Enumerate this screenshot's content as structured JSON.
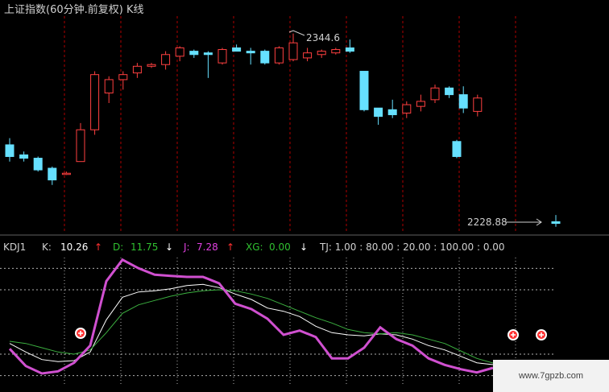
{
  "colors": {
    "up": "#ff4040",
    "down": "#66e0ff",
    "grid": "#b00000",
    "k": "#ffffff",
    "d": "#3cb040",
    "j": "#d050d0",
    "text": "#d0d0d0",
    "k_value": "#ffffff",
    "d_value": "#30c030",
    "j_value": "#e040e0",
    "xg_value": "#30c030",
    "arrow_up": "#ff3030",
    "arrow_down": "#ffffff",
    "dotted": "#b0b0b0",
    "marker": "#ff3030"
  },
  "main": {
    "title": "上证指数(60分钟.前复权) K线",
    "high_label": "2344.6",
    "low_label": "2228.88"
  },
  "indicator": {
    "name": "KDJ1",
    "k_label": "K:",
    "k_value": "10.26",
    "k_arrow": "↑",
    "d_label": "D:",
    "d_value": "11.75",
    "d_arrow": "↓",
    "j_label": "J:",
    "j_value": "7.28",
    "j_arrow": "↑",
    "xg_label": "XG:",
    "xg_value": "0.00",
    "xg_arrow": "↓",
    "tj_text": "TJ: 1.00  : 80.00 : 20.00 : 100.00 : 0.00"
  },
  "watermark": "www.7gpzb.com",
  "chart_data": [
    {
      "type": "candlestick",
      "title": "上证指数(60分钟.前复权) K线",
      "ylim": [
        2225,
        2355
      ],
      "annotations": [
        {
          "label": "2344.6",
          "value": 2344.6
        },
        {
          "label": "2228.88",
          "value": 2228.88
        }
      ],
      "candles": [
        {
          "o": 2278,
          "h": 2282,
          "l": 2268,
          "c": 2271
        },
        {
          "o": 2272,
          "h": 2274,
          "l": 2268,
          "c": 2270
        },
        {
          "o": 2270,
          "h": 2271,
          "l": 2262,
          "c": 2263
        },
        {
          "o": 2264,
          "h": 2265,
          "l": 2254,
          "c": 2257
        },
        {
          "o": 2261,
          "h": 2262,
          "l": 2260,
          "c": 2261
        },
        {
          "o": 2268,
          "h": 2291,
          "l": 2268,
          "c": 2287
        },
        {
          "o": 2287,
          "h": 2322,
          "l": 2284,
          "c": 2320
        },
        {
          "o": 2309,
          "h": 2319,
          "l": 2303,
          "c": 2317
        },
        {
          "o": 2317,
          "h": 2322,
          "l": 2311,
          "c": 2320
        },
        {
          "o": 2321,
          "h": 2327,
          "l": 2318,
          "c": 2325
        },
        {
          "o": 2325,
          "h": 2327,
          "l": 2324,
          "c": 2326
        },
        {
          "o": 2326,
          "h": 2334,
          "l": 2323,
          "c": 2332
        },
        {
          "o": 2331,
          "h": 2337,
          "l": 2328,
          "c": 2336
        },
        {
          "o": 2334,
          "h": 2335,
          "l": 2330,
          "c": 2332
        },
        {
          "o": 2333,
          "h": 2334,
          "l": 2318,
          "c": 2332
        },
        {
          "o": 2327,
          "h": 2336,
          "l": 2326,
          "c": 2335
        },
        {
          "o": 2336,
          "h": 2338,
          "l": 2335,
          "c": 2334
        },
        {
          "o": 2334,
          "h": 2336,
          "l": 2326,
          "c": 2333
        },
        {
          "o": 2334,
          "h": 2335,
          "l": 2326,
          "c": 2327
        },
        {
          "o": 2327,
          "h": 2337,
          "l": 2326,
          "c": 2336
        },
        {
          "o": 2329,
          "h": 2344.6,
          "l": 2328,
          "c": 2339
        },
        {
          "o": 2330,
          "h": 2336,
          "l": 2328,
          "c": 2333
        },
        {
          "o": 2332,
          "h": 2335,
          "l": 2330,
          "c": 2334
        },
        {
          "o": 2333,
          "h": 2336,
          "l": 2332,
          "c": 2335
        },
        {
          "o": 2336,
          "h": 2341,
          "l": 2333,
          "c": 2334
        },
        {
          "o": 2322,
          "h": 2322,
          "l": 2298,
          "c": 2299
        },
        {
          "o": 2300,
          "h": 2300,
          "l": 2290,
          "c": 2295
        },
        {
          "o": 2299,
          "h": 2305,
          "l": 2294,
          "c": 2296
        },
        {
          "o": 2297,
          "h": 2304,
          "l": 2294,
          "c": 2302
        },
        {
          "o": 2301,
          "h": 2308,
          "l": 2298,
          "c": 2304
        },
        {
          "o": 2305,
          "h": 2314,
          "l": 2303,
          "c": 2312
        },
        {
          "o": 2312,
          "h": 2313,
          "l": 2306,
          "c": 2308
        },
        {
          "o": 2308,
          "h": 2313,
          "l": 2297,
          "c": 2300
        },
        {
          "o": 2298,
          "h": 2308,
          "l": 2295,
          "c": 2306
        },
        {
          "o": 2280,
          "h": 2281,
          "l": 2270,
          "c": 2271
        },
        {
          "o": 2232,
          "h": 2236,
          "l": 2229,
          "c": 2231
        }
      ]
    },
    {
      "type": "line",
      "title": "KDJ1",
      "ylim": [
        -10,
        110
      ],
      "reference_lines": [
        80,
        20,
        100,
        0
      ],
      "series": [
        {
          "name": "K",
          "values": [
            30,
            22,
            15,
            13,
            14,
            22,
            52,
            73,
            78,
            79,
            81,
            84,
            85,
            82,
            76,
            71,
            63,
            60,
            55,
            46,
            40,
            38,
            37,
            39,
            38,
            34,
            28,
            24,
            18,
            12,
            10.26
          ]
        },
        {
          "name": "D",
          "values": [
            32,
            30,
            26,
            22,
            20,
            24,
            40,
            58,
            66,
            70,
            74,
            77,
            79,
            80,
            79,
            76,
            72,
            66,
            60,
            54,
            49,
            43,
            40,
            39,
            40,
            38,
            34,
            30,
            23,
            16,
            11.75
          ]
        },
        {
          "name": "J",
          "values": [
            25,
            9,
            2,
            4,
            12,
            28,
            88,
            108,
            100,
            94,
            93,
            92,
            92,
            86,
            67,
            62,
            53,
            38,
            42,
            36,
            16,
            16,
            26,
            45,
            34,
            28,
            16,
            10,
            6,
            3,
            7.28
          ]
        }
      ]
    }
  ]
}
